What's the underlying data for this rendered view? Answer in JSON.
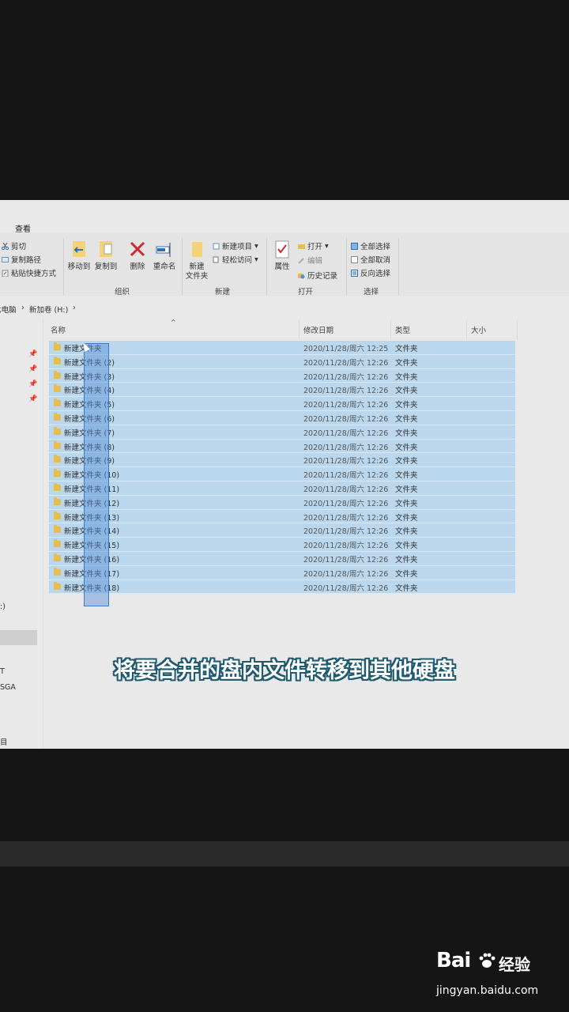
{
  "ribbon": {
    "tab_view": "查看",
    "clipboard": {
      "cut": "剪切",
      "copy_path": "复制路径",
      "paste_shortcut": "粘贴快捷方式"
    },
    "organize": {
      "move_to": "移动到",
      "copy_to": "复制到",
      "delete": "删除",
      "rename": "重命名",
      "group_label": "组织"
    },
    "new": {
      "new_folder_line1": "新建",
      "new_folder_line2": "文件夹",
      "new_item": "新建项目",
      "easy_access": "轻松访问",
      "group_label": "新建"
    },
    "open": {
      "properties": "属性",
      "open": "打开",
      "edit": "编辑",
      "history": "历史记录",
      "group_label": "打开"
    },
    "select": {
      "select_all": "全部选择",
      "select_none": "全部取消",
      "invert": "反向选择",
      "group_label": "选择"
    }
  },
  "address": {
    "crumb_pc": "此电脑",
    "crumb_drive": "新加卷 (H:)"
  },
  "columns": {
    "name": "名称",
    "date": "修改日期",
    "type": "类型",
    "size": "大小"
  },
  "files": [
    {
      "name": "新建文件夹",
      "date": "2020/11/28/周六 12:25",
      "type": "文件夹"
    },
    {
      "name": "新建文件夹 (2)",
      "date": "2020/11/28/周六 12:26",
      "type": "文件夹"
    },
    {
      "name": "新建文件夹 (3)",
      "date": "2020/11/28/周六 12:26",
      "type": "文件夹"
    },
    {
      "name": "新建文件夹 (4)",
      "date": "2020/11/28/周六 12:26",
      "type": "文件夹"
    },
    {
      "name": "新建文件夹 (5)",
      "date": "2020/11/28/周六 12:26",
      "type": "文件夹"
    },
    {
      "name": "新建文件夹 (6)",
      "date": "2020/11/28/周六 12:26",
      "type": "文件夹"
    },
    {
      "name": "新建文件夹 (7)",
      "date": "2020/11/28/周六 12:26",
      "type": "文件夹"
    },
    {
      "name": "新建文件夹 (8)",
      "date": "2020/11/28/周六 12:26",
      "type": "文件夹"
    },
    {
      "name": "新建文件夹 (9)",
      "date": "2020/11/28/周六 12:26",
      "type": "文件夹"
    },
    {
      "name": "新建文件夹 (10)",
      "date": "2020/11/28/周六 12:26",
      "type": "文件夹"
    },
    {
      "name": "新建文件夹 (11)",
      "date": "2020/11/28/周六 12:26",
      "type": "文件夹"
    },
    {
      "name": "新建文件夹 (12)",
      "date": "2020/11/28/周六 12:26",
      "type": "文件夹"
    },
    {
      "name": "新建文件夹 (13)",
      "date": "2020/11/28/周六 12:26",
      "type": "文件夹"
    },
    {
      "name": "新建文件夹 (14)",
      "date": "2020/11/28/周六 12:26",
      "type": "文件夹"
    },
    {
      "name": "新建文件夹 (15)",
      "date": "2020/11/28/周六 12:26",
      "type": "文件夹"
    },
    {
      "name": "新建文件夹 (16)",
      "date": "2020/11/28/周六 12:26",
      "type": "文件夹"
    },
    {
      "name": "新建文件夹 (17)",
      "date": "2020/11/28/周六 12:26",
      "type": "文件夹"
    },
    {
      "name": "新建文件夹 (18)",
      "date": "2020/11/28/周六 12:26",
      "type": "文件夹"
    }
  ],
  "nav": {
    "drive_frag": ":)",
    "item_t": "T",
    "item_sga": "SGA",
    "footer_frag": "目"
  },
  "caption": "将要合并的盘内文件转移到其他硬盘",
  "watermark": {
    "logo": "Bai",
    "logo_cn": "经验",
    "url": "jingyan.baidu.com"
  },
  "colors": {
    "selection": "#bad7ee",
    "folder": "#e8bd4f",
    "caption_outline": "#1e5a70"
  }
}
